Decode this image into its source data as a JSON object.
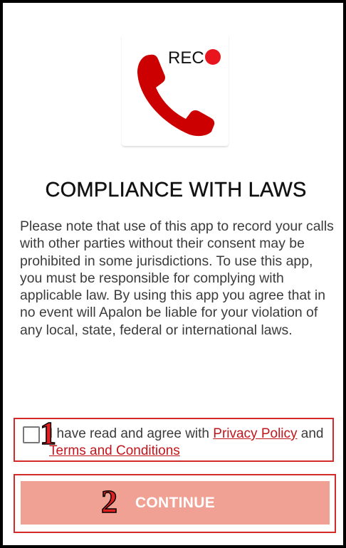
{
  "logo": {
    "rec_label": "REC",
    "icons": [
      "phone-handset-icon",
      "record-dot-icon"
    ]
  },
  "page": {
    "title": "COMPLIANCE WITH LAWS",
    "body": "Please note that use of this app to record your calls with other parties without their consent may be prohibited in some jurisdictions. To use this app, you must be responsible for complying with applicable law. By using this app you agree that in no event will Apalon be liable for your violation of any local, state, federal or international laws."
  },
  "agreement": {
    "checked": false,
    "text_before": "I have read and agree with ",
    "privacy_label": "Privacy Policy",
    "text_middle": " and ",
    "terms_label": "Terms and Conditions"
  },
  "continue": {
    "label": "CONTINUE"
  },
  "annotations": {
    "step1": "1",
    "step2": "2"
  },
  "colors": {
    "brand_red": "#cc0000",
    "record_dot": "#e8141e",
    "link_red": "#c0151b",
    "continue_bg": "#f0a193",
    "annotation_border": "#d42a2a"
  }
}
